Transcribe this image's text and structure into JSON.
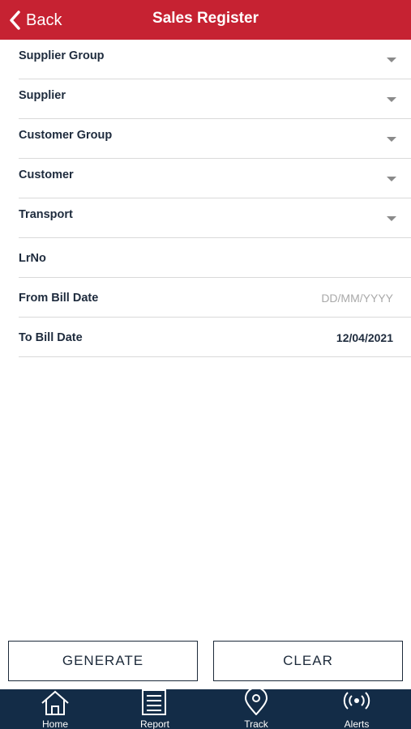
{
  "header": {
    "back_label": "Back",
    "title": "Sales Register"
  },
  "form": {
    "supplier_group": "Supplier Group",
    "supplier": "Supplier",
    "customer_group": "Customer Group",
    "customer": "Customer",
    "transport": "Transport",
    "lr_no": "LrNo",
    "from_bill_date": {
      "label": "From Bill Date",
      "placeholder": "DD/MM/YYYY"
    },
    "to_bill_date": {
      "label": "To Bill Date",
      "value": "12/04/2021"
    }
  },
  "actions": {
    "generate": "GENERATE",
    "clear": "CLEAR"
  },
  "tabs": [
    {
      "label": "Home",
      "icon": "home-icon"
    },
    {
      "label": "Report",
      "icon": "report-icon"
    },
    {
      "label": "Track",
      "icon": "location-pin-icon"
    },
    {
      "label": "Alerts",
      "icon": "broadcast-icon"
    }
  ],
  "colors": {
    "header_bg": "#c62232",
    "tabbar_bg": "#132c47",
    "text": "#1e2b3d"
  }
}
